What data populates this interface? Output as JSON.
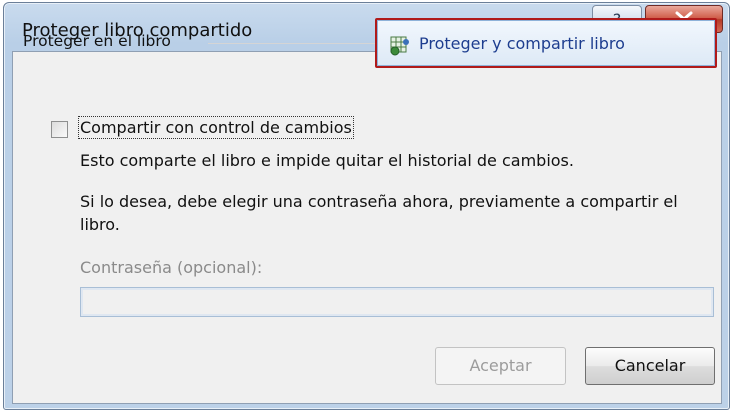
{
  "dialog": {
    "title": "Proteger libro compartido",
    "help_icon": "help-question-icon",
    "close_icon": "close-x-icon"
  },
  "group": {
    "label": "Proteger en el libro"
  },
  "protect_button": {
    "label": "Proteger y compartir libro",
    "icon": "workbook-protect-icon"
  },
  "share_checkbox": {
    "label": "Compartir con control de cambios",
    "checked": false
  },
  "description": {
    "line1": "Esto comparte el libro e impide quitar el historial de cambios.",
    "line2": "Si lo desea, debe elegir una contraseña ahora, previamente a compartir el libro."
  },
  "password": {
    "label": "Contraseña (opcional):",
    "value": ""
  },
  "buttons": {
    "ok_label": "Aceptar",
    "cancel_label": "Cancelar"
  },
  "colors": {
    "highlight_border": "#b01a1a",
    "link_blue": "#1d3d8f"
  }
}
